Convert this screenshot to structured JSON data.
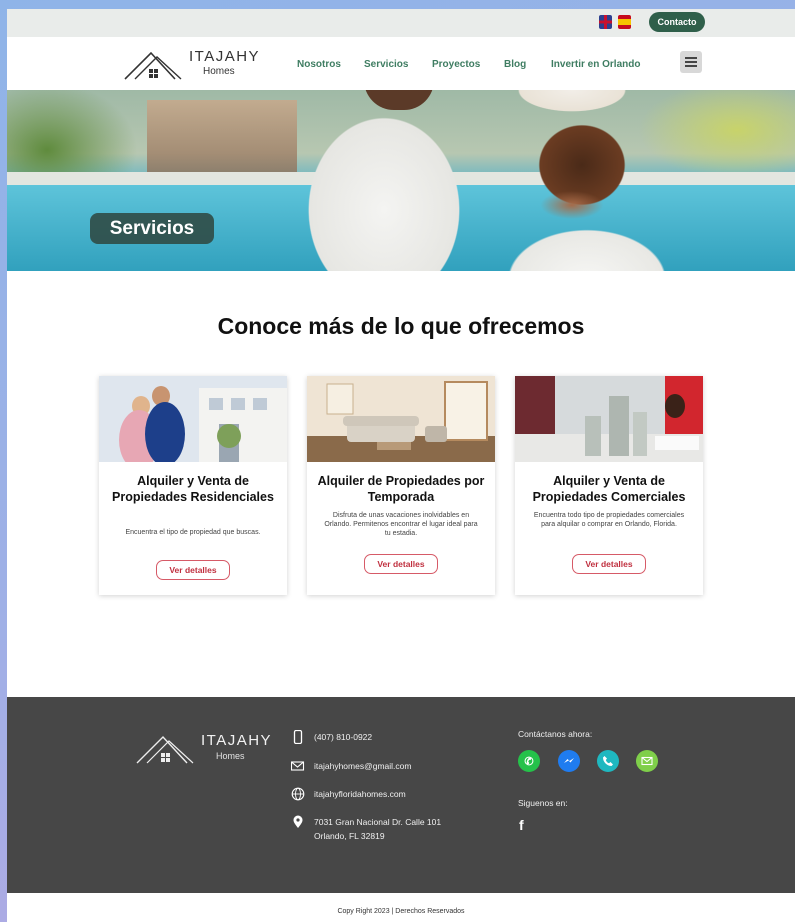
{
  "topbar": {
    "flags": [
      "uk-flag-icon",
      "spain-flag-icon"
    ],
    "contact_label": "Contacto"
  },
  "brand": {
    "name": "ITAJAHY",
    "sub": "Homes"
  },
  "nav": {
    "items": [
      "Nosotros",
      "Servicios",
      "Proyectos",
      "Blog",
      "Invertir en Orlando"
    ],
    "menu_icon": "hamburger-menu-icon"
  },
  "hero": {
    "label": "Servicios"
  },
  "section": {
    "title": "Conoce más de lo que ofrecemos"
  },
  "cards": [
    {
      "title": "Alquiler y Venta de Propiedades Residenciales",
      "description": "Encuentra el tipo de propiedad que buscas.",
      "button": "Ver detalles"
    },
    {
      "title": "Alquiler de Propiedades por Temporada",
      "description": "Disfruta de unas vacaciones inolvidables en Orlando. Permitenos encontrar el lugar ideal para tu estadia.",
      "button": "Ver detalles"
    },
    {
      "title": "Alquiler y Venta de Propiedades Comerciales",
      "description": "Encuentra todo tipo de propiedades comerciales para alquilar o comprar en Orlando, Florida.",
      "button": "Ver detalles"
    }
  ],
  "footer": {
    "phone": "(407) 810-0922",
    "email": "itajahyhomes@gmail.com",
    "website": "itajahyfloridahomes.com",
    "address_line1": "7031 Gran Nacional Dr. Calle 101",
    "address_line2": "Orlando, FL 32819",
    "contact_heading": "Contáctanos ahora:",
    "follow_heading": "Siguenos en:",
    "social": [
      "whatsapp-icon",
      "messenger-icon",
      "phone-icon",
      "email-icon"
    ],
    "follow_icon": "facebook-icon",
    "colors": {
      "whatsapp": "#25c24a",
      "messenger": "#1f7cf0",
      "phone": "#1fb8c0",
      "email": "#7fcf4a"
    }
  },
  "copyright": "Copy Right 2023 | Derechos Reservados"
}
